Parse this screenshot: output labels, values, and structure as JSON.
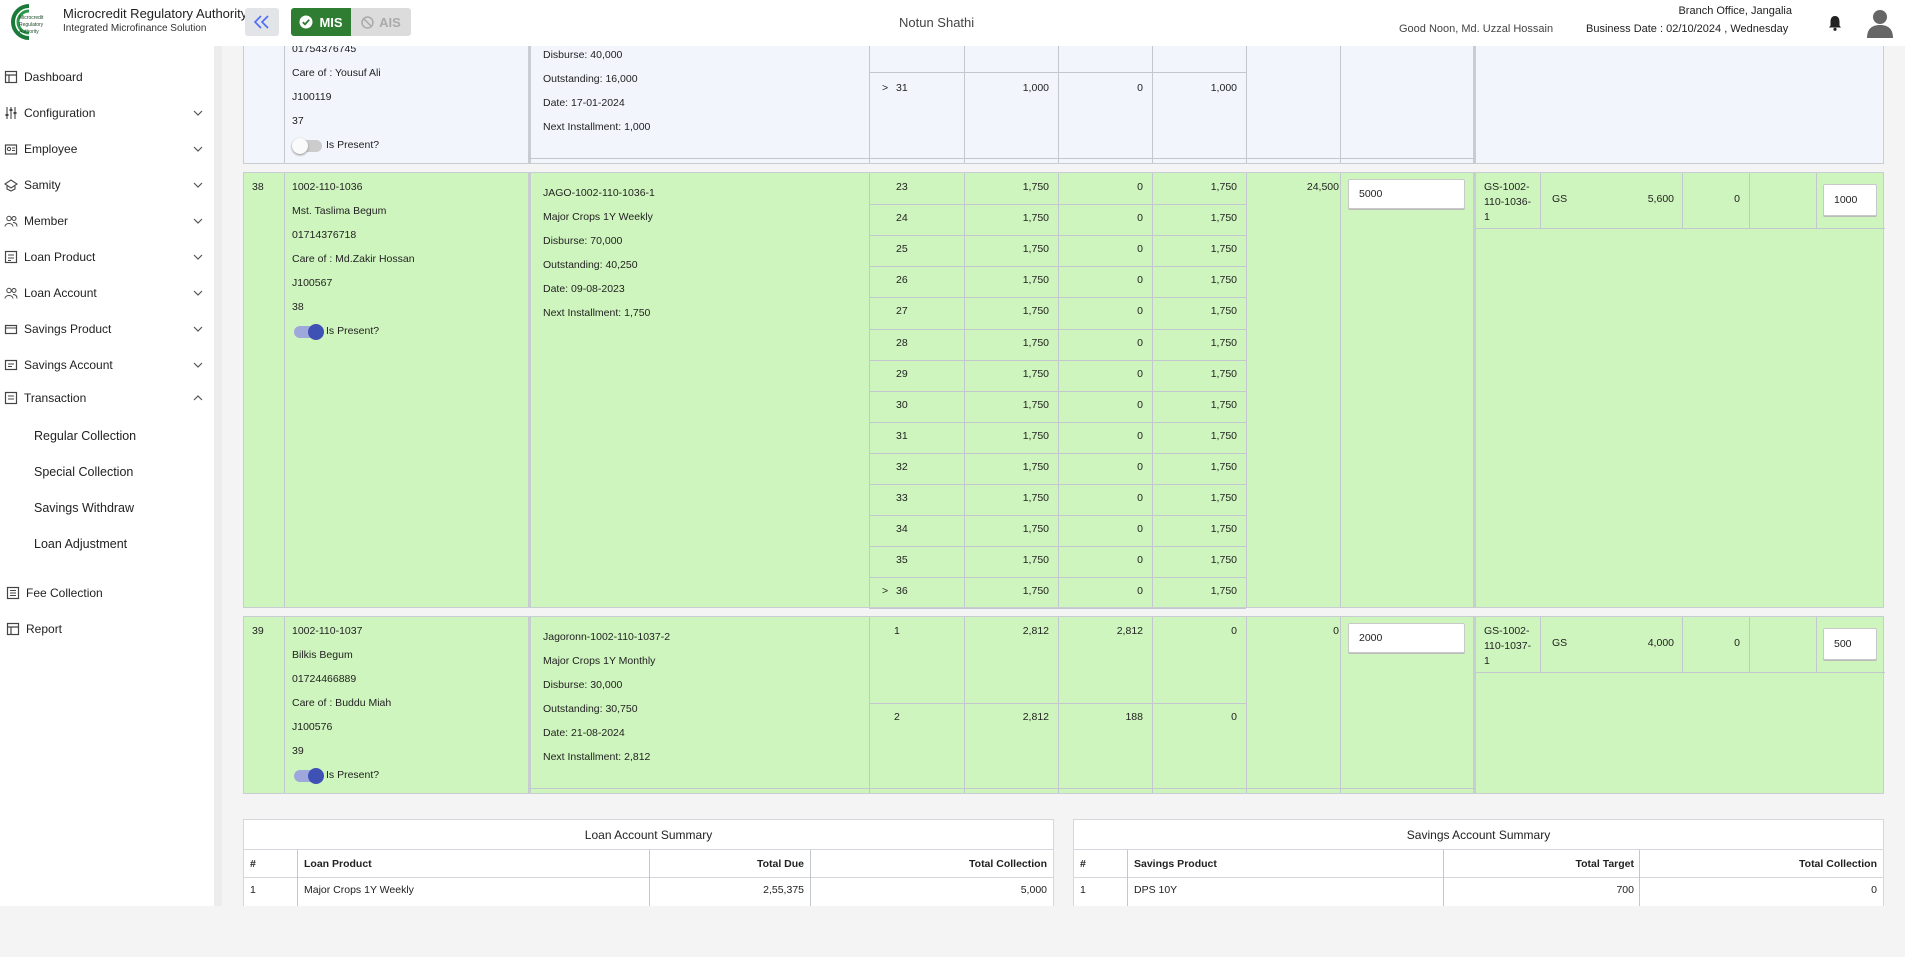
{
  "header": {
    "brand_title": "Microcredit Regulatory Authority",
    "brand_subtitle": "Integrated Microfinance Solution",
    "logo_text": "Microcredit Regulatory Authority",
    "mis_label": "MIS",
    "ais_label": "AIS",
    "center_title": "Notun Shathi",
    "greeting": "Good Noon, Md. Uzzal Hossain",
    "branch": "Branch Office, Jangalia",
    "business_date": "Business Date : 02/10/2024 , Wednesday"
  },
  "sidebar": {
    "items": [
      {
        "label": "Dashboard",
        "icon": "dashboard-icon"
      },
      {
        "label": "Configuration",
        "icon": "sliders-icon"
      },
      {
        "label": "Employee",
        "icon": "employee-icon"
      },
      {
        "label": "Samity",
        "icon": "samity-icon"
      },
      {
        "label": "Member",
        "icon": "member-icon"
      },
      {
        "label": "Loan Product",
        "icon": "loan-product-icon"
      },
      {
        "label": "Loan Account",
        "icon": "loan-account-icon"
      },
      {
        "label": "Savings Product",
        "icon": "savings-product-icon"
      },
      {
        "label": "Savings Account",
        "icon": "savings-account-icon"
      },
      {
        "label": "Transaction",
        "icon": "transaction-icon"
      }
    ],
    "transaction_sub": [
      "Regular Collection",
      "Special Collection",
      "Savings Withdraw",
      "Loan Adjustment"
    ],
    "fee_collection": "Fee Collection",
    "report": "Report"
  },
  "member37": {
    "mobile": "01754376745",
    "care_of": "Care of : Yousuf Ali",
    "id": "J100119",
    "sl": "37",
    "present_label": "Is Present?",
    "loan": {
      "disburse": "Disburse: 40,000",
      "outstanding": "Outstanding: 16,000",
      "date": "Date: 17-01-2024",
      "next_installment": "Next Installment: 1,000"
    },
    "installment": {
      "marker": ">",
      "no": "31",
      "due": "1,000",
      "paid": "0",
      "balance": "1,000"
    }
  },
  "member38": {
    "sl": "38",
    "code": "1002-110-1036",
    "name": "Mst. Taslima Begum",
    "mobile": "01714376718",
    "care_of": "Care of : Md.Zakir Hossan",
    "id": "J100567",
    "serial": "38",
    "present_label": "Is Present?",
    "loan": {
      "account": "JAGO-1002-110-1036-1",
      "product": "Major Crops 1Y Weekly",
      "disburse": "Disburse: 70,000",
      "outstanding": "Outstanding: 40,250",
      "date": "Date: 09-08-2023",
      "next_installment": "Next Installment: 1,750"
    },
    "installments": [
      {
        "marker": "",
        "no": "23",
        "due": "1,750",
        "paid": "0",
        "balance": "1,750"
      },
      {
        "marker": "",
        "no": "24",
        "due": "1,750",
        "paid": "0",
        "balance": "1,750"
      },
      {
        "marker": "",
        "no": "25",
        "due": "1,750",
        "paid": "0",
        "balance": "1,750"
      },
      {
        "marker": "",
        "no": "26",
        "due": "1,750",
        "paid": "0",
        "balance": "1,750"
      },
      {
        "marker": "",
        "no": "27",
        "due": "1,750",
        "paid": "0",
        "balance": "1,750"
      },
      {
        "marker": "",
        "no": "28",
        "due": "1,750",
        "paid": "0",
        "balance": "1,750"
      },
      {
        "marker": "",
        "no": "29",
        "due": "1,750",
        "paid": "0",
        "balance": "1,750"
      },
      {
        "marker": "",
        "no": "30",
        "due": "1,750",
        "paid": "0",
        "balance": "1,750"
      },
      {
        "marker": "",
        "no": "31",
        "due": "1,750",
        "paid": "0",
        "balance": "1,750"
      },
      {
        "marker": "",
        "no": "32",
        "due": "1,750",
        "paid": "0",
        "balance": "1,750"
      },
      {
        "marker": "",
        "no": "33",
        "due": "1,750",
        "paid": "0",
        "balance": "1,750"
      },
      {
        "marker": "",
        "no": "34",
        "due": "1,750",
        "paid": "0",
        "balance": "1,750"
      },
      {
        "marker": "",
        "no": "35",
        "due": "1,750",
        "paid": "0",
        "balance": "1,750"
      },
      {
        "marker": ">",
        "no": "36",
        "due": "1,750",
        "paid": "0",
        "balance": "1,750"
      }
    ],
    "total_due": "24,500",
    "collection_input": "5000",
    "savings": {
      "account": "GS-1002-\n110-1036-\n1",
      "type": "GS",
      "balance": "5,600",
      "withdraw": "0",
      "deposit_input": "1000"
    }
  },
  "member39": {
    "sl": "39",
    "code": "1002-110-1037",
    "name": "Bilkis Begum",
    "mobile": "01724466889",
    "care_of": "Care of : Buddu Miah",
    "id": "J100576",
    "serial": "39",
    "present_label": "Is Present?",
    "loan": {
      "account": "Jagoronn-1002-110-1037-2",
      "product": "Major Crops 1Y Monthly",
      "disburse": "Disburse: 30,000",
      "outstanding": "Outstanding: 30,750",
      "date": "Date: 21-08-2024",
      "next_installment": "Next Installment: 2,812"
    },
    "installments": [
      {
        "no": "1",
        "due": "2,812",
        "paid": "2,812",
        "balance": "0"
      },
      {
        "no": "2",
        "due": "2,812",
        "paid": "188",
        "balance": "0"
      }
    ],
    "total_due": "0",
    "collection_input": "2000",
    "savings": {
      "account": "GS-1002-\n110-1037-\n1",
      "type": "GS",
      "balance": "4,000",
      "withdraw": "0",
      "deposit_input": "500"
    }
  },
  "loan_summary": {
    "title": "Loan Account Summary",
    "headers": [
      "#",
      "Loan Product",
      "Total Due",
      "Total Collection"
    ],
    "rows": [
      {
        "sl": "1",
        "product": "Major Crops 1Y Weekly",
        "due": "2,55,375",
        "collection": "5,000"
      }
    ]
  },
  "savings_summary": {
    "title": "Savings Account Summary",
    "headers": [
      "#",
      "Savings Product",
      "Total Target",
      "Total Collection"
    ],
    "rows": [
      {
        "sl": "1",
        "product": "DPS 10Y",
        "target": "700",
        "collection": "0"
      }
    ]
  },
  "colors": {
    "row_green": "#cff5be",
    "row_blue": "#f2f5fc",
    "mis_green": "#2e7d32",
    "toggle_on": "#3f51b5"
  }
}
